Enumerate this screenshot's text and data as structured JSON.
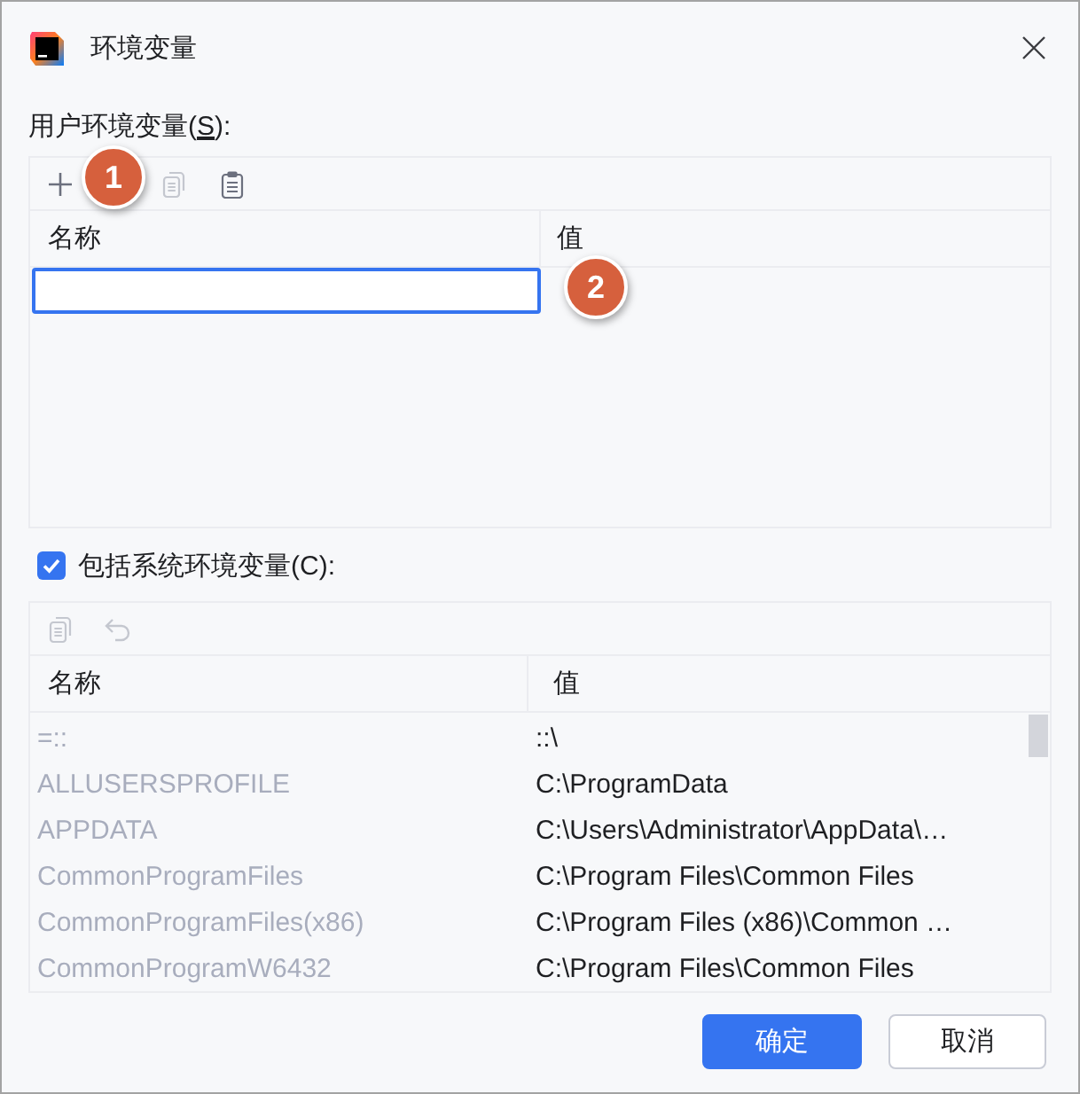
{
  "window": {
    "title": "环境变量"
  },
  "user_section": {
    "label": [
      {
        "text": "用户环境变量(",
        "underlined": false
      },
      {
        "text": "S",
        "underlined": true
      },
      {
        "text": "):",
        "underlined": false
      }
    ],
    "toolbar": [
      {
        "kind": "add",
        "disabled": false
      },
      {
        "kind": "copy",
        "disabled": true
      },
      {
        "kind": "paste",
        "disabled": false
      }
    ],
    "columns": [
      "名称",
      "值"
    ],
    "editing_new_row": true
  },
  "system_section": {
    "include_checkbox": {
      "label": "包括系统环境变量(C):",
      "checked": true
    },
    "toolbar": [
      {
        "kind": "copy",
        "disabled": true
      },
      {
        "kind": "undo",
        "disabled": true
      }
    ],
    "columns": [
      "名称",
      "值"
    ],
    "rows": [
      {
        "name": "=::",
        "value": "::\\"
      },
      {
        "name": "ALLUSERSPROFILE",
        "value": "C:\\ProgramData"
      },
      {
        "name": "APPDATA",
        "value": "C:\\Users\\Administrator\\AppData\\…"
      },
      {
        "name": "CommonProgramFiles",
        "value": "C:\\Program Files\\Common Files"
      },
      {
        "name": "CommonProgramFiles(x86)",
        "value": "C:\\Program Files (x86)\\Common …"
      },
      {
        "name": "CommonProgramW6432",
        "value": "C:\\Program Files\\Common Files"
      }
    ]
  },
  "markers": [
    {
      "label": "1"
    },
    {
      "label": "2"
    }
  ],
  "buttons": [
    {
      "label": "确定",
      "default": true
    },
    {
      "label": "取消",
      "default": false
    }
  ]
}
